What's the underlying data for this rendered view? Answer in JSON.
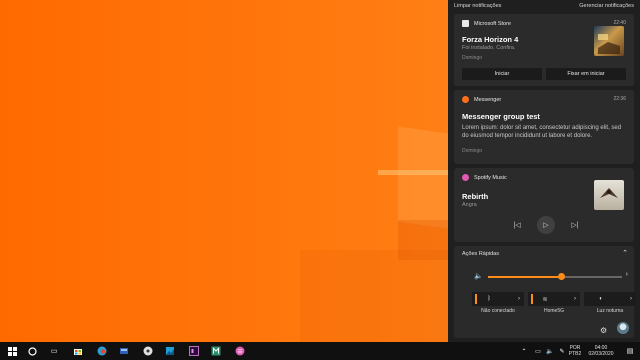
{
  "action_center": {
    "clear_label": "Limpar notificações",
    "manage_label": "Gerenciar notificações",
    "store_card": {
      "app": "Microsoft Store",
      "time": "22:40",
      "title": "Forza Horizon 4",
      "subtitle": "Foi instalado. Confira.",
      "day": "Domingo",
      "btn_start": "Iniciar",
      "btn_pin": "Fixar em iniciar"
    },
    "messenger_card": {
      "app": "Messenger",
      "time": "22:36",
      "title": "Messenger group test",
      "body": "Lorem ipsum: dolor sit amet, consectetur adipiscing elit, sed do eiusmod tempor incididunt ut labore et dolore.",
      "day": "Domingo"
    },
    "spotify_card": {
      "app": "Spotify Music",
      "title": "Rebirth",
      "artist": "Angra"
    },
    "quick_actions": {
      "title": "Ações Rápidas",
      "volume_percent": 55,
      "tiles": [
        {
          "label": "Não conectado",
          "icon": "bluetooth-icon"
        },
        {
          "label": "Home5G",
          "icon": "wifi-icon"
        },
        {
          "label": "Luz noturna",
          "icon": "night-light-icon"
        }
      ]
    }
  },
  "tray": {
    "language": "POR",
    "layout": "PTB2",
    "time": "04:00",
    "date": "02/03/2020"
  },
  "colors": {
    "accent": "#ff8c1a",
    "panel": "#1f1f1f",
    "card": "#2b2b2b"
  }
}
